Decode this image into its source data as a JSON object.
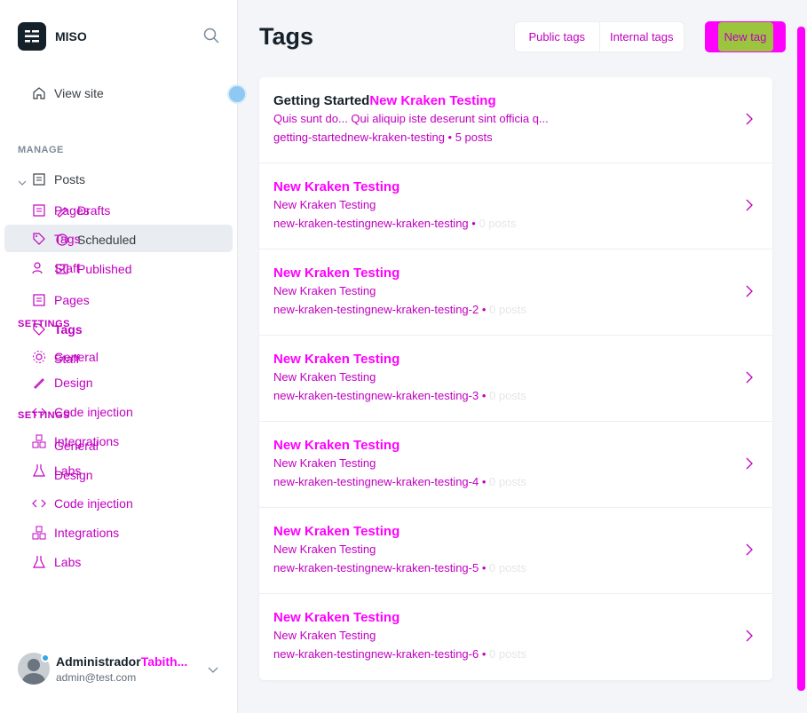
{
  "sidebar": {
    "brand": "MISO",
    "view_site": "View site",
    "manage_label": "MANAGE",
    "settings_label": "SETTINGS",
    "settings_label_2": "SETTINGS",
    "nav": {
      "posts": "Posts",
      "drafts": "Drafts",
      "scheduled": "Scheduled",
      "published": "Published",
      "pages": "Pages",
      "pages_ghost": "Pages",
      "tags": "Tags",
      "tags_active": "Tags",
      "staff": "Staff",
      "staff_ghost": "Staff",
      "general": "General",
      "general_2": "General",
      "design": "Design",
      "design_2": "Design",
      "code_injection": "Code injection",
      "code_injection_2": "Code injection",
      "integrations": "Integrations",
      "integrations_2": "Integrations",
      "labs": "Labs",
      "labs_2": "Labs"
    },
    "user": {
      "name": "Administrador",
      "name_overlay": "Tabith...",
      "email": "admin@test.com"
    }
  },
  "header": {
    "title": "Tags",
    "public_tags": "Public tags",
    "internal_tags": "Internal tags",
    "new_tag": "New tag"
  },
  "tags": [
    {
      "title_a": "Getting Started",
      "title_b": "New Kraken Testing",
      "description": "Quis sunt do... Qui aliquip iste deserunt sint officia q...",
      "slug": "getting-startednew-kraken-testing",
      "count": "5 posts"
    },
    {
      "title_b": "New Kraken Testing",
      "description": "New Kraken Testing",
      "slug": "new-kraken-testingnew-kraken-testing",
      "count": "0 posts"
    },
    {
      "title_b": "New Kraken Testing",
      "description": "New Kraken Testing",
      "slug": "new-kraken-testingnew-kraken-testing-2",
      "count": "0 posts"
    },
    {
      "title_b": "New Kraken Testing",
      "description": "New Kraken Testing",
      "slug": "new-kraken-testingnew-kraken-testing-3",
      "count": "0 posts"
    },
    {
      "title_b": "New Kraken Testing",
      "description": "New Kraken Testing",
      "slug": "new-kraken-testingnew-kraken-testing-4",
      "count": "0 posts"
    },
    {
      "title_b": "New Kraken Testing",
      "description": "New Kraken Testing",
      "slug": "new-kraken-testingnew-kraken-testing-5",
      "count": "0 posts"
    },
    {
      "title_b": "New Kraken Testing",
      "description": "New Kraken Testing",
      "slug": "new-kraken-testingnew-kraken-testing-6",
      "count": "0 posts"
    }
  ],
  "colors": {
    "diff_magenta": "#ff00ff",
    "diff_dark_magenta": "#c000c0",
    "button_green": "#9bc53d",
    "sidebar_bg": "#ffffff",
    "main_bg": "#f4f5f8"
  }
}
